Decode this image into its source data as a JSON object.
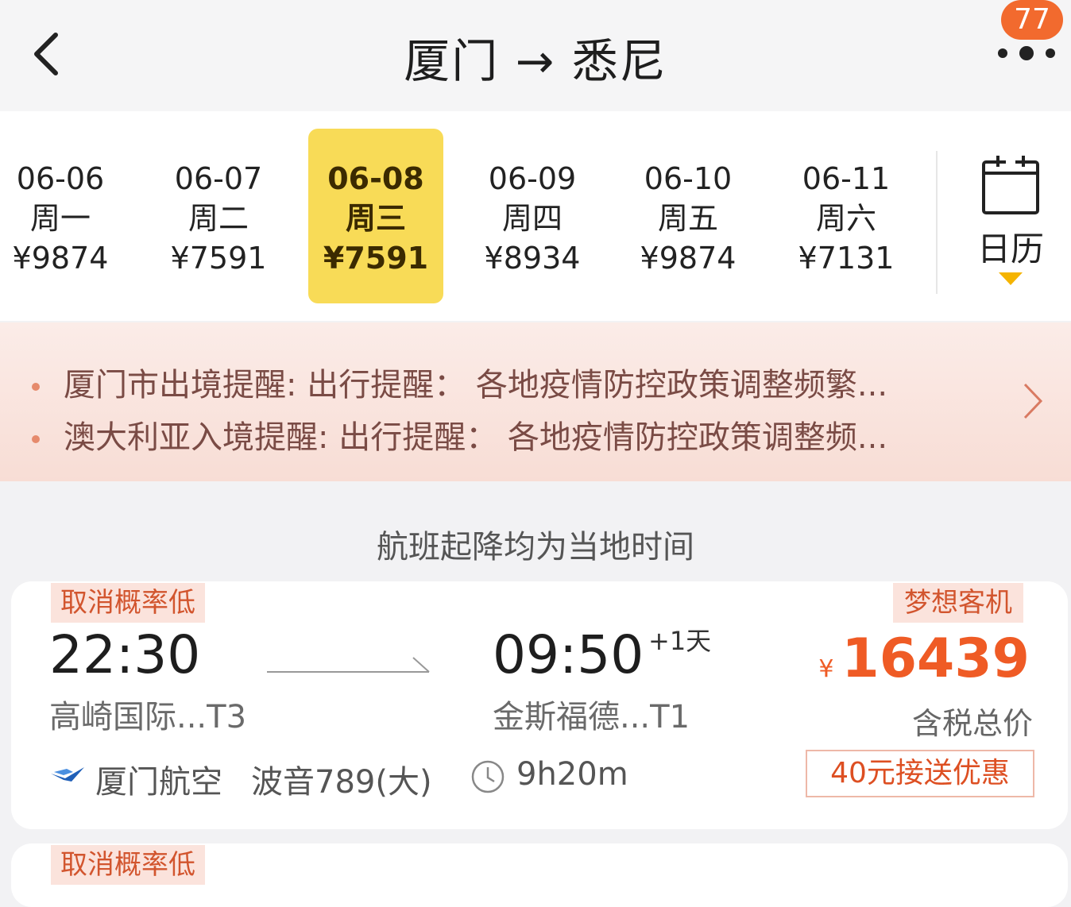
{
  "header": {
    "title": "厦门 → 悉尼",
    "badge_count": "77",
    "back_icon": "chevron-left-icon",
    "more_icon": "more-dots-icon"
  },
  "dates": [
    {
      "date": "06-06",
      "weekday": "周一",
      "price": "¥9874",
      "selected": false
    },
    {
      "date": "06-07",
      "weekday": "周二",
      "price": "¥7591",
      "selected": false
    },
    {
      "date": "06-08",
      "weekday": "周三",
      "price": "¥7591",
      "selected": true
    },
    {
      "date": "06-09",
      "weekday": "周四",
      "price": "¥8934",
      "selected": false
    },
    {
      "date": "06-10",
      "weekday": "周五",
      "price": "¥9874",
      "selected": false
    },
    {
      "date": "06-11",
      "weekday": "周六",
      "price": "¥7131",
      "selected": false
    }
  ],
  "calendar": {
    "label": "日历",
    "icon": "calendar-icon"
  },
  "notices": [
    "厦门市出境提醒: 出行提醒： 各地疫情防控政策调整频繁...",
    "澳大利亚入境提醒: 出行提醒： 各地疫情防控政策调整频..."
  ],
  "local_time_note": "航班起降均为当地时间",
  "flights": [
    {
      "tag": "取消概率低",
      "plane_tag": "梦想客机",
      "dep_time": "22:30",
      "arr_time": "09:50",
      "plus_day": "+1天",
      "dep_airport": "高崎国际...T3",
      "arr_airport": "金斯福德...T1",
      "currency": "¥",
      "price": "16439",
      "price_label": "含税总价",
      "promo": "40元接送优惠",
      "airline": "厦门航空",
      "aircraft": "波音789(大)",
      "duration": "9h20m"
    },
    {
      "tag": "取消概率低"
    }
  ],
  "colors": {
    "accent": "#ef5b25",
    "selected_date_bg": "#f8db57",
    "tag_bg": "#fbe3dc"
  }
}
